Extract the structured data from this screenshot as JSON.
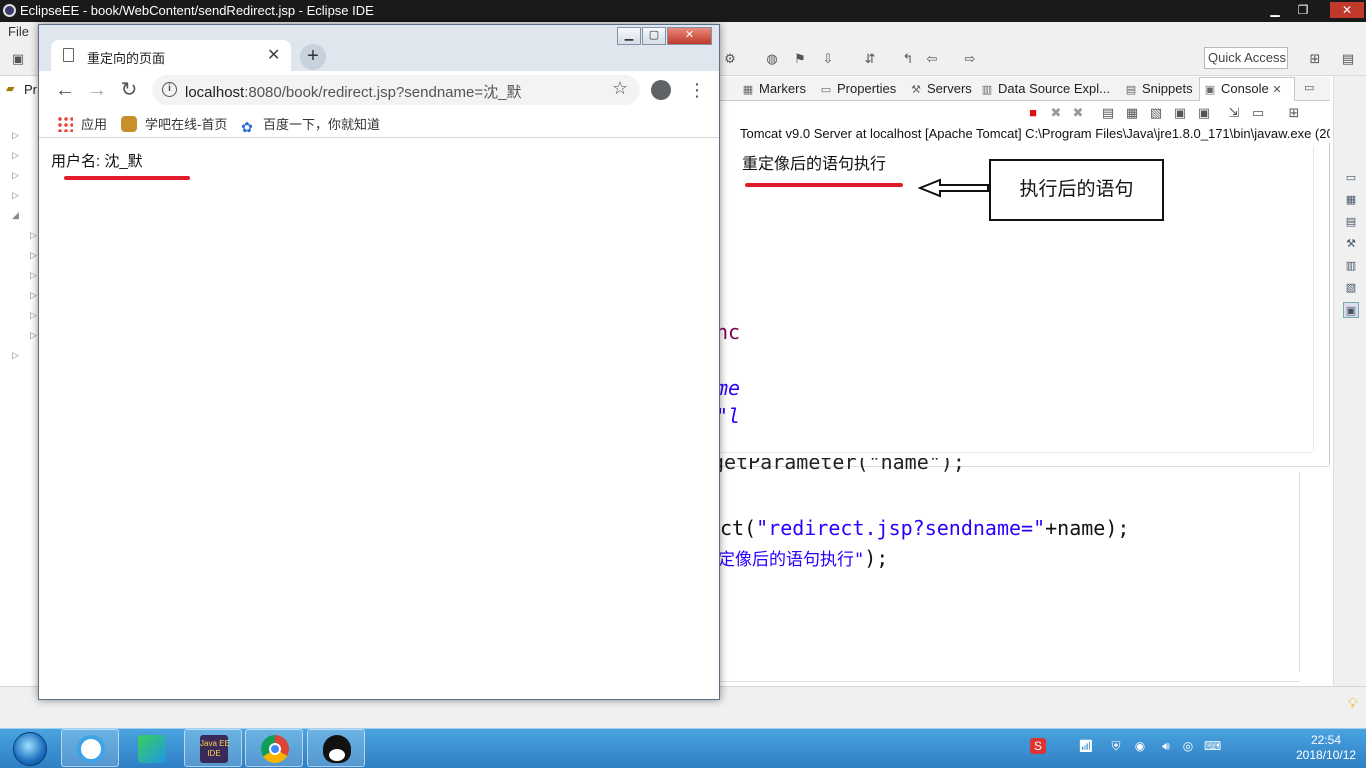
{
  "eclipse": {
    "window_title": "EclipseEE - book/WebContent/sendRedirect.jsp - Eclipse IDE",
    "menu": [
      "File"
    ],
    "quick_access": "Quick Access",
    "left_tab_label": "Pr",
    "views": {
      "tabs": [
        "Markers",
        "Properties",
        "Servers",
        "Data Source Expl...",
        "Snippets",
        "Console"
      ],
      "active_tab": "Console"
    },
    "console": {
      "header": "Tomcat v9.0 Server at localhost [Apache Tomcat] C:\\Program Files\\Java\\jre1.8.0_171\\bin\\javaw.exe (20",
      "output_line": "重定像后的语句执行"
    },
    "editor": {
      "fragments": [
        "nc",
        "me",
        "\"l",
        "getParameter(\"name\");"
      ],
      "line_redirect": {
        "prefix": "ct(",
        "string": "\"redirect.jsp?sendname=\"",
        "suffix": "+name);"
      },
      "line_print": {
        "string": "定像后的语句执行\"",
        "suffix": ");"
      }
    }
  },
  "annotation": {
    "text": "执行后的语句"
  },
  "chrome": {
    "tab_title": "重定向的页面",
    "new_tab": "+",
    "url_host": "localhost",
    "url_rest": ":8080/book/redirect.jsp?sendname=沈_默",
    "bookmarks": [
      "应用",
      "学吧在线-首页",
      "百度一下，你就知道"
    ],
    "page_text": "用户名: 沈_默"
  },
  "taskbar": {
    "apps": [
      "internet-explorer",
      "media-player",
      "java-ee-ide",
      "chrome",
      "qq"
    ],
    "java_ide_label": "Java EE\nIDE",
    "time": "22:54",
    "date": "2018/10/12"
  },
  "colors": {
    "highlight_underline": "#e11b2b",
    "code_string": "#2a00ff",
    "code_keyword": "#7f0055"
  }
}
